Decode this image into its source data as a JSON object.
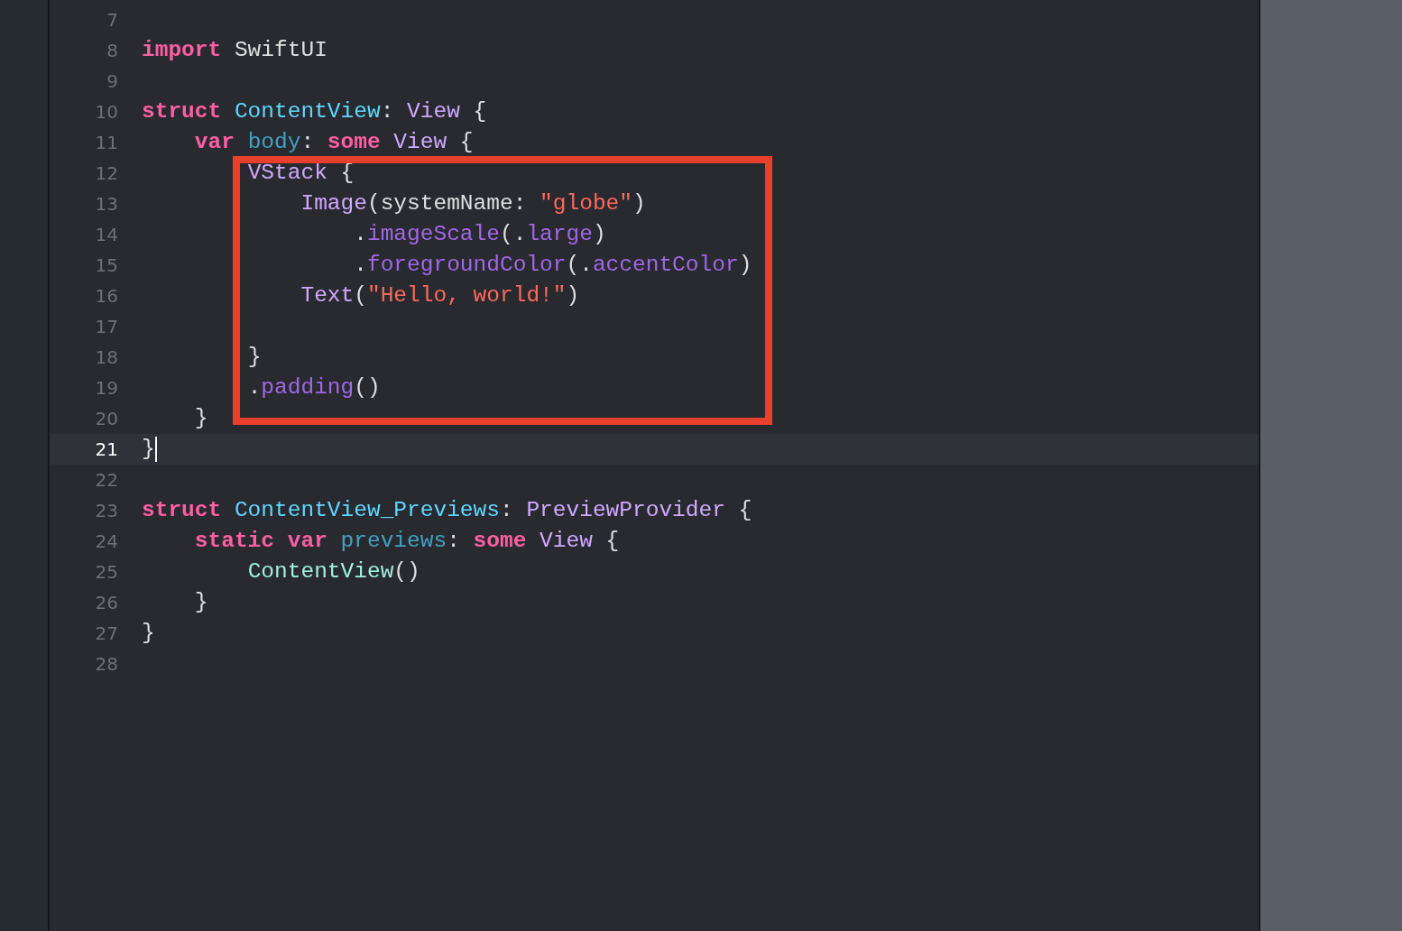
{
  "editor": {
    "lines": [
      {
        "number": "7",
        "current": false,
        "framed": false
      },
      {
        "number": "8",
        "current": false,
        "framed": false,
        "tokens": [
          {
            "text": "import ",
            "kind": "keyword"
          },
          {
            "text": "SwiftUI",
            "kind": "plain"
          }
        ]
      },
      {
        "number": "9",
        "current": false,
        "framed": false
      },
      {
        "number": "10",
        "current": false,
        "framed": false,
        "tokens": [
          {
            "text": "struct ",
            "kind": "keyword"
          },
          {
            "text": "ContentView",
            "kind": "declaration"
          },
          {
            "text": ": ",
            "kind": "plain"
          },
          {
            "text": "View",
            "kind": "type"
          },
          {
            "text": " {",
            "kind": "plain"
          }
        ]
      },
      {
        "number": "11",
        "current": false,
        "framed": false,
        "tokens": [
          {
            "text": "    var ",
            "kind": "keyword"
          },
          {
            "text": "body",
            "kind": "property"
          },
          {
            "text": ": ",
            "kind": "plain"
          },
          {
            "text": "some ",
            "kind": "keyword"
          },
          {
            "text": "View",
            "kind": "type"
          },
          {
            "text": " {",
            "kind": "plain"
          }
        ]
      },
      {
        "number": "12",
        "current": false,
        "framed": true,
        "tokens": [
          {
            "text": "        VStack",
            "kind": "type"
          },
          {
            "text": " {",
            "kind": "plain"
          }
        ]
      },
      {
        "number": "13",
        "current": false,
        "framed": true,
        "tokens": [
          {
            "text": "            Image",
            "kind": "type"
          },
          {
            "text": "(systemName: ",
            "kind": "plain"
          },
          {
            "text": "\"globe\"",
            "kind": "string"
          },
          {
            "text": ")",
            "kind": "plain"
          }
        ]
      },
      {
        "number": "14",
        "current": false,
        "framed": true,
        "tokens": [
          {
            "text": "                .",
            "kind": "plain"
          },
          {
            "text": "imageScale",
            "kind": "method"
          },
          {
            "text": "(.",
            "kind": "plain"
          },
          {
            "text": "large",
            "kind": "method"
          },
          {
            "text": ")",
            "kind": "plain"
          }
        ]
      },
      {
        "number": "15",
        "current": false,
        "framed": true,
        "tokens": [
          {
            "text": "                .",
            "kind": "plain"
          },
          {
            "text": "foregroundColor",
            "kind": "method"
          },
          {
            "text": "(.",
            "kind": "plain"
          },
          {
            "text": "accentColor",
            "kind": "method"
          },
          {
            "text": ")",
            "kind": "plain"
          }
        ]
      },
      {
        "number": "16",
        "current": false,
        "framed": true,
        "tokens": [
          {
            "text": "            Text",
            "kind": "type"
          },
          {
            "text": "(",
            "kind": "plain"
          },
          {
            "text": "\"Hello, world!\"",
            "kind": "string"
          },
          {
            "text": ")",
            "kind": "plain"
          }
        ]
      },
      {
        "number": "17",
        "current": false,
        "framed": true
      },
      {
        "number": "18",
        "current": false,
        "framed": true,
        "tokens": [
          {
            "text": "        }",
            "kind": "plain"
          }
        ]
      },
      {
        "number": "19",
        "current": false,
        "framed": true,
        "tokens": [
          {
            "text": "        .",
            "kind": "plain"
          },
          {
            "text": "padding",
            "kind": "method"
          },
          {
            "text": "()",
            "kind": "plain"
          }
        ]
      },
      {
        "number": "20",
        "current": false,
        "framed": false,
        "tokens": [
          {
            "text": "    }",
            "kind": "plain"
          }
        ]
      },
      {
        "number": "21",
        "current": true,
        "framed": false,
        "tokens": [
          {
            "text": "}",
            "kind": "plain"
          }
        ]
      },
      {
        "number": "22",
        "current": false,
        "framed": false
      },
      {
        "number": "23",
        "current": false,
        "framed": false,
        "tokens": [
          {
            "text": "struct ",
            "kind": "keyword"
          },
          {
            "text": "ContentView_Previews",
            "kind": "declaration"
          },
          {
            "text": ": ",
            "kind": "plain"
          },
          {
            "text": "PreviewProvider",
            "kind": "type"
          },
          {
            "text": " {",
            "kind": "plain"
          }
        ]
      },
      {
        "number": "24",
        "current": false,
        "framed": false,
        "tokens": [
          {
            "text": "    static var ",
            "kind": "keyword"
          },
          {
            "text": "previews",
            "kind": "property"
          },
          {
            "text": ": ",
            "kind": "plain"
          },
          {
            "text": "some ",
            "kind": "keyword"
          },
          {
            "text": "View",
            "kind": "type"
          },
          {
            "text": " {",
            "kind": "plain"
          }
        ]
      },
      {
        "number": "25",
        "current": false,
        "framed": false,
        "tokens": [
          {
            "text": "        ContentView",
            "kind": "project"
          },
          {
            "text": "()",
            "kind": "plain"
          }
        ]
      },
      {
        "number": "26",
        "current": false,
        "framed": false,
        "tokens": [
          {
            "text": "    }",
            "kind": "plain"
          }
        ]
      },
      {
        "number": "27",
        "current": false,
        "framed": false,
        "tokens": [
          {
            "text": "}",
            "kind": "plain"
          }
        ]
      },
      {
        "number": "28",
        "current": false,
        "framed": false
      }
    ]
  }
}
